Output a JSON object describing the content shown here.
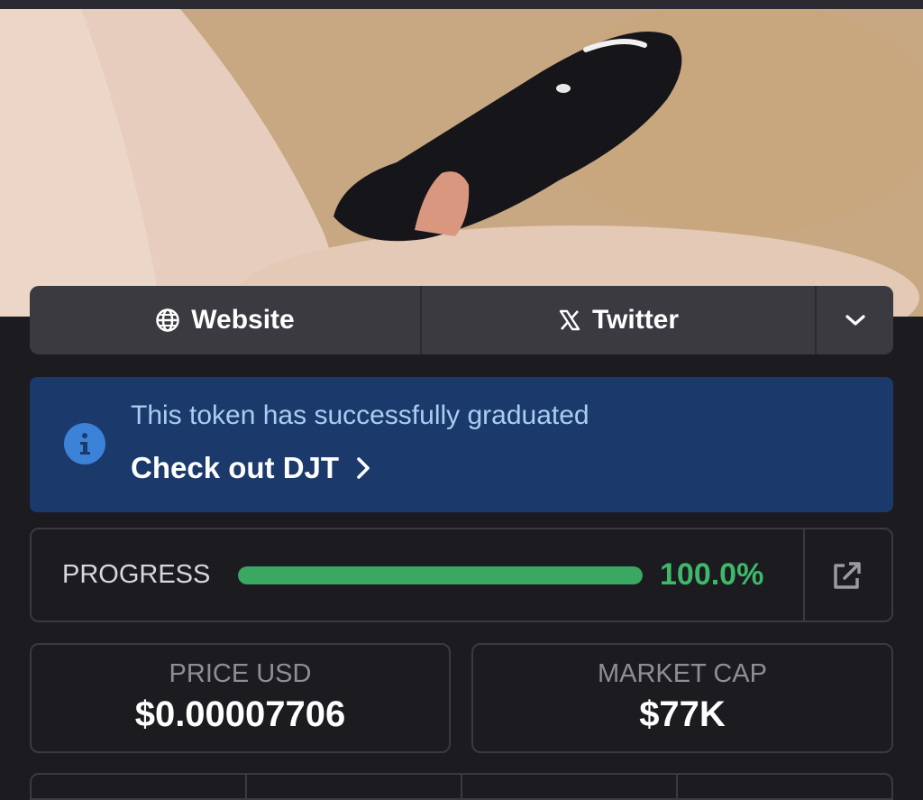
{
  "links": {
    "website_label": "Website",
    "twitter_label": "Twitter"
  },
  "banner": {
    "message": "This token has successfully graduated",
    "link_label": "Check out DJT"
  },
  "progress": {
    "label": "PROGRESS",
    "value_text": "100.0%",
    "fraction": 1.0
  },
  "stats": {
    "price_label": "PRICE USD",
    "price_value": "$0.00007706",
    "market_cap_label": "MARKET CAP",
    "market_cap_value": "$77K"
  },
  "colors": {
    "background": "#1b1b20",
    "banner": "#1b3a6b",
    "progress_green": "#3fb86a",
    "info_blue": "#3b82d8"
  },
  "icons": [
    "globe-icon",
    "x-logo-icon",
    "chevron-down-icon",
    "info-icon",
    "chevron-right-icon",
    "external-link-icon"
  ]
}
